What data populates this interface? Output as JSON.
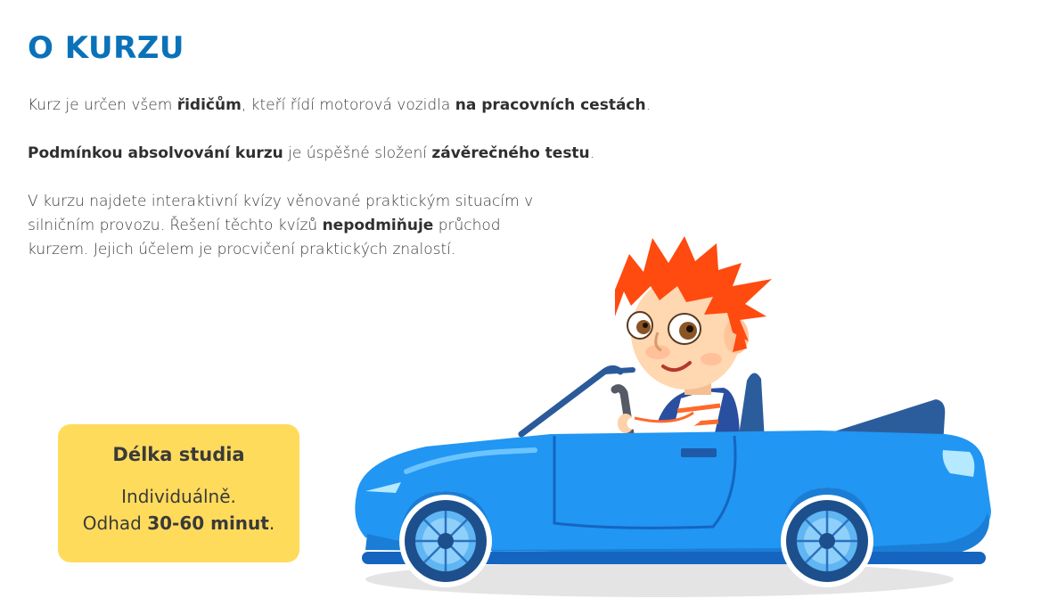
{
  "heading": "O KURZU",
  "paragraphs": {
    "p1": {
      "t1": "Kurz je určen všem ",
      "b1": "řidičům",
      "t2": ", kteří řídí motorová vozidla ",
      "b2": "na pracovních cestách",
      "t3": "."
    },
    "p2": {
      "b1": "Podmínkou absolvování kurzu",
      "t1": " je úspěšné složení ",
      "b2": "závěrečného testu",
      "t2": "."
    },
    "p3": {
      "t1": "V kurzu najdete interaktivní kvízy věnované praktickým situacím v silničním provozu. Řešení těchto kvízů ",
      "b1": "nepodmiňuje",
      "t2": " průchod kurzem. Jejich účelem je procvičení praktických znalostí."
    }
  },
  "duration_box": {
    "title": "Délka studia",
    "line1": "Individuálně.",
    "line2_prefix": "Odhad ",
    "line2_bold": "30-60 minut",
    "line2_suffix": "."
  },
  "colors": {
    "heading": "#0b72b9",
    "box_background": "#ffdb5c",
    "car_body": "#2196f3",
    "hair": "#ff4a10"
  },
  "illustration": {
    "icon": "boy-driving-convertible-car-illustration"
  }
}
